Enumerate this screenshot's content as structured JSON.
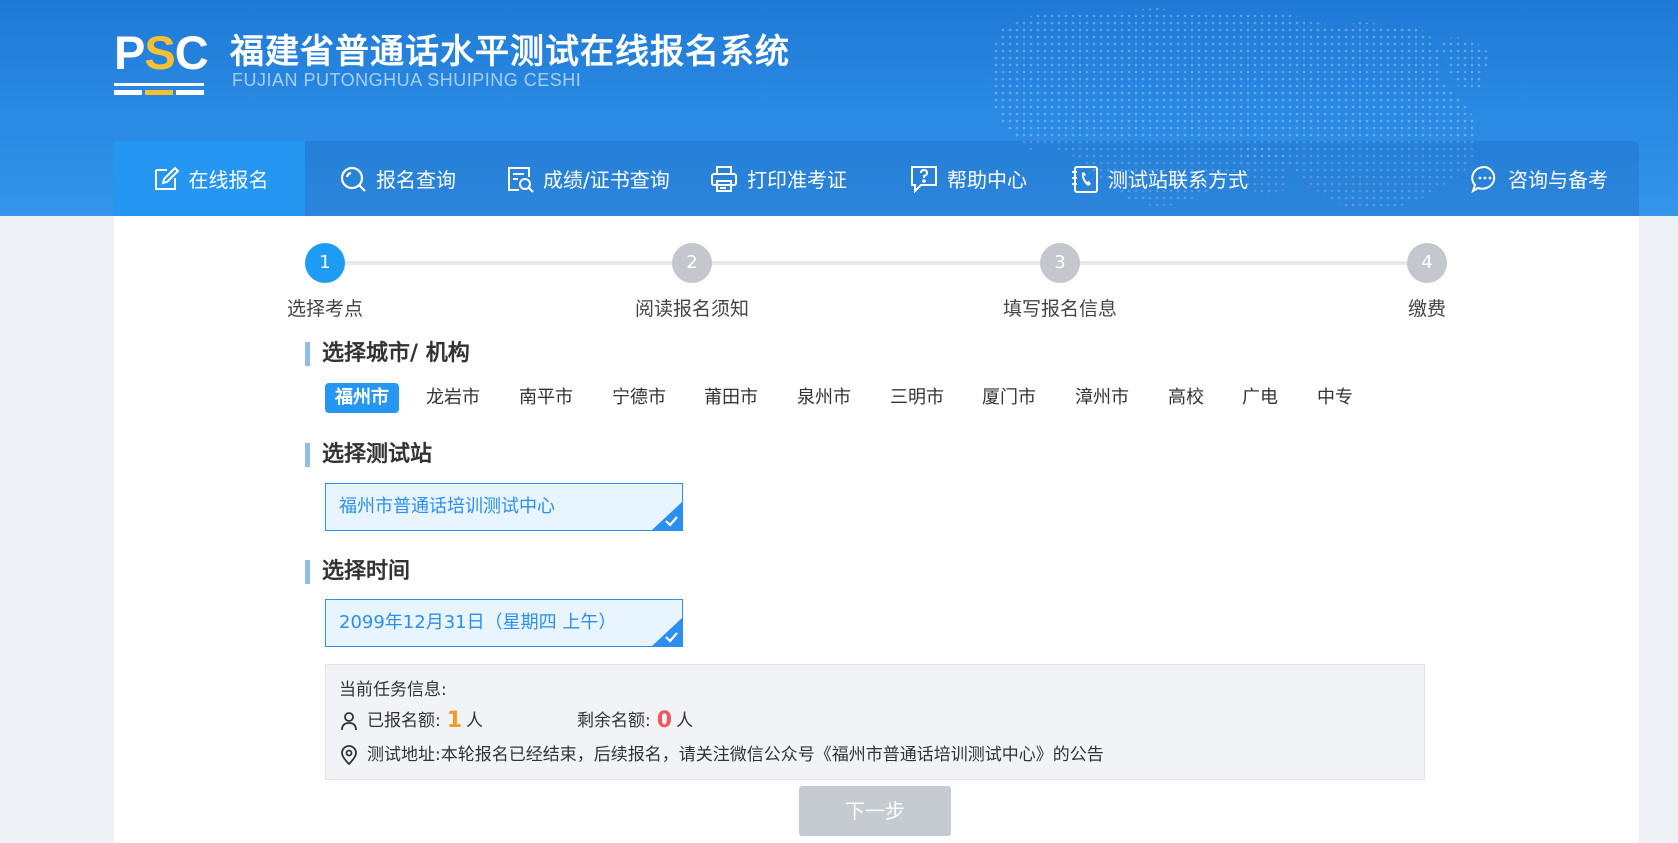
{
  "header": {
    "logo_text_p": "P",
    "logo_text_s": "S",
    "logo_text_c": "C",
    "title": "福建省普通话水平测试在线报名系统",
    "subtitle": "FUJIAN PUTONGHUA SHUIPING CESHI"
  },
  "nav": {
    "items": [
      {
        "label": "在线报名",
        "icon": "edit-icon",
        "active": true
      },
      {
        "label": "报名查询",
        "icon": "search-icon"
      },
      {
        "label": "成绩/证书查询",
        "icon": "document-search-icon"
      },
      {
        "label": "打印准考证",
        "icon": "printer-icon"
      },
      {
        "label": "帮助中心",
        "icon": "help-icon"
      },
      {
        "label": "测试站联系方式",
        "icon": "phone-book-icon"
      },
      {
        "label": "咨询与备考",
        "icon": "chat-icon"
      }
    ]
  },
  "steps": [
    {
      "number": "1",
      "label": "选择考点",
      "active": true
    },
    {
      "number": "2",
      "label": "阅读报名须知"
    },
    {
      "number": "3",
      "label": "填写报名信息"
    },
    {
      "number": "4",
      "label": "缴费"
    }
  ],
  "city_section": {
    "title": "选择城市/ 机构",
    "cities": [
      "福州市",
      "龙岩市",
      "南平市",
      "宁德市",
      "莆田市",
      "泉州市",
      "三明市",
      "厦门市",
      "漳州市",
      "高校",
      "广电",
      "中专"
    ],
    "selected": "福州市"
  },
  "station_section": {
    "title": "选择测试站",
    "selected": "福州市普通话培训测试中心"
  },
  "time_section": {
    "title": "选择时间",
    "selected": "2099年12月31日（星期四 上午）"
  },
  "task_info": {
    "heading": "当前任务信息:",
    "registered_label": "已报名额:",
    "registered_value": "1",
    "registered_unit": "人",
    "remaining_label": "剩余名额:",
    "remaining_value": "0",
    "remaining_unit": "人",
    "address_label": "测试地址:",
    "address_value": "本轮报名已经结束，后续报名，请关注微信公众号《福州市普通话培训测试中心》的公告"
  },
  "next_button": "下一步",
  "colors": {
    "primary": "#2696f3",
    "header_bg": "#1f7ad6",
    "orange": "#f59a23",
    "red": "#f2565b",
    "disabled": "#c6cbd2"
  }
}
